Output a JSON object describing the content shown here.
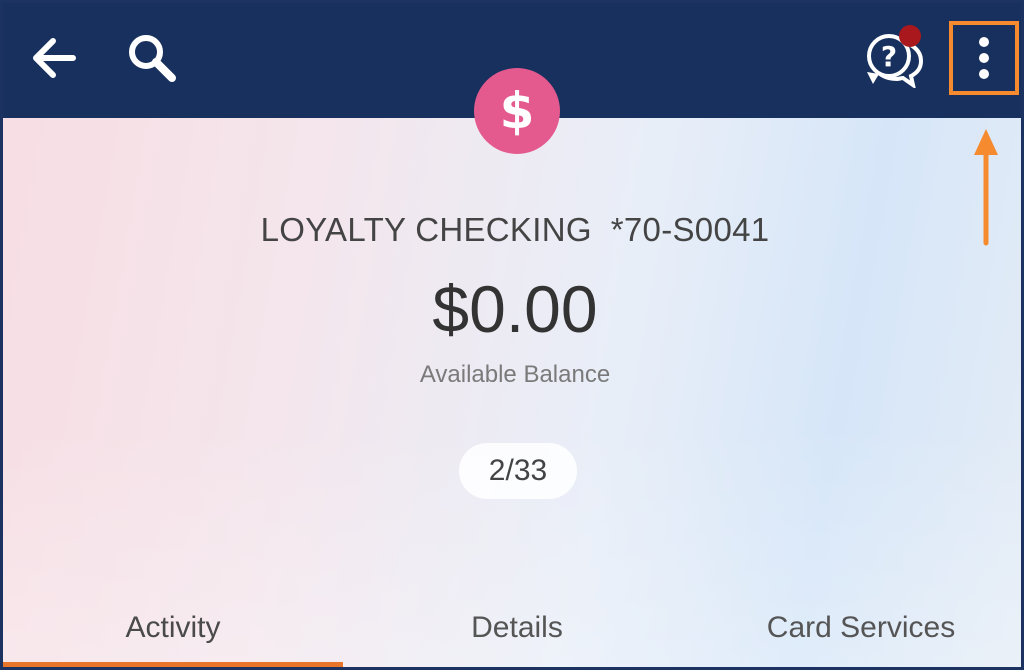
{
  "header": {
    "back_icon": "arrow-left-icon",
    "search_icon": "search-icon",
    "help_icon": "help-chat-icon",
    "more_icon": "vertical-dots-icon",
    "avatar_symbol": "$",
    "highlight_color": "#f58a2e",
    "bar_color": "#17305e"
  },
  "account": {
    "name": "LOYALTY CHECKING",
    "number": "*70-S0041",
    "balance": "$0.00",
    "balance_label": "Available Balance",
    "pager": "2/33",
    "avatar_color": "#e45a8e"
  },
  "tabs": [
    {
      "label": "Activity",
      "active": true
    },
    {
      "label": "Details",
      "active": false
    },
    {
      "label": "Card Services",
      "active": false
    }
  ],
  "accent_color": "#e8752a"
}
